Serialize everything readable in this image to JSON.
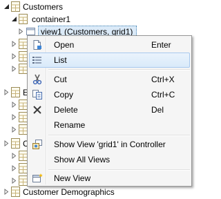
{
  "tree": {
    "nodes": [
      {
        "label": "Customers",
        "expanded": true
      },
      {
        "label": "container1",
        "expanded": true
      },
      {
        "label": "view1 (Customers, grid1)",
        "expanded": false,
        "selected": true
      },
      {
        "label": "",
        "expanded": false
      },
      {
        "label": "",
        "expanded": false
      },
      {
        "label": "",
        "expanded": false
      },
      {
        "label": "En",
        "expanded": false
      },
      {
        "label": "",
        "expanded": false
      },
      {
        "label": "",
        "expanded": false
      },
      {
        "label": "",
        "expanded": false
      },
      {
        "label": "C",
        "expanded": false
      },
      {
        "label": "",
        "expanded": false
      },
      {
        "label": "",
        "expanded": false
      },
      {
        "label": "",
        "expanded": false
      },
      {
        "label": "Customer Demographics",
        "expanded": false
      }
    ]
  },
  "context_menu": {
    "items": [
      {
        "label": "Open",
        "shortcut": "Enter",
        "icon": "open-icon"
      },
      {
        "label": "List",
        "shortcut": "",
        "icon": "list-icon",
        "highlighted": true
      },
      {
        "label": "Cut",
        "shortcut": "Ctrl+X",
        "icon": "scissors-icon"
      },
      {
        "label": "Copy",
        "shortcut": "Ctrl+C",
        "icon": "copy-icon"
      },
      {
        "label": "Delete",
        "shortcut": "Del",
        "icon": "delete-icon"
      },
      {
        "label": "Rename",
        "shortcut": "",
        "icon": ""
      },
      {
        "label": "Show View 'grid1' in Controller",
        "shortcut": "",
        "icon": "show-in-controller-icon"
      },
      {
        "label": "Show All Views",
        "shortcut": "",
        "icon": ""
      },
      {
        "label": "New View",
        "shortcut": "",
        "icon": "new-view-icon"
      }
    ]
  },
  "colors": {
    "highlight_border": "#a8c9ee",
    "highlight_fill": "#d9eafa",
    "menu_background": "#f5f5f5",
    "selection_border": "#3c7fb1"
  }
}
